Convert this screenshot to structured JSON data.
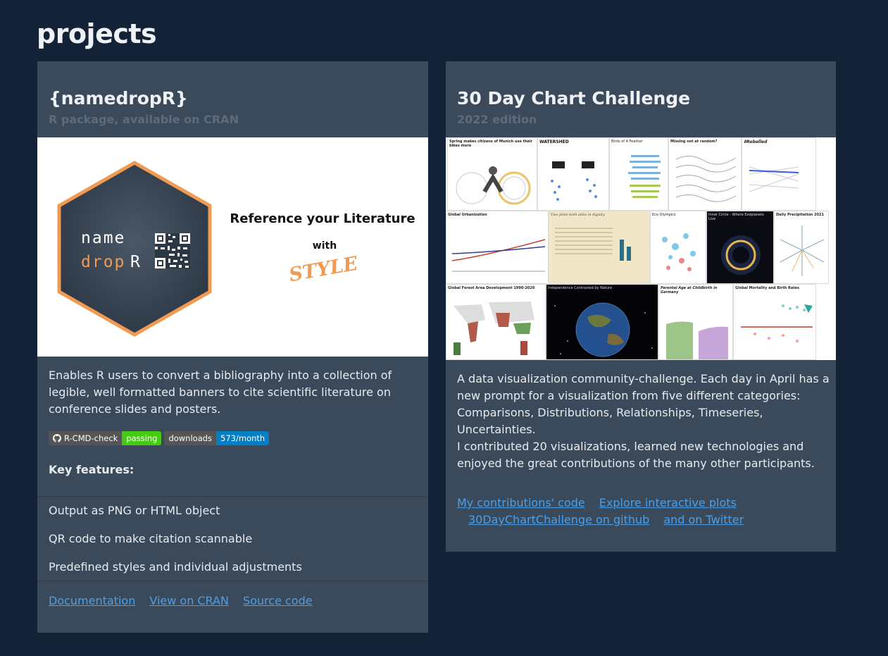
{
  "page": {
    "title": "projects"
  },
  "card1": {
    "title": "{namedropR}",
    "subtitle": "R package, available on CRAN",
    "banner": {
      "hex_name_line1": "name",
      "hex_name_line2a": "drop",
      "hex_name_line2b": "R",
      "headline": "Reference your Literature",
      "with": "with",
      "style": "STYLE"
    },
    "description": "Enables R users to convert a bibliography into a collection of legible, well formatted banners to cite scientific literature on conference slides and posters.",
    "badges": [
      {
        "label": "R-CMD-check",
        "value": "passing"
      },
      {
        "label": "downloads",
        "value": "573/month"
      }
    ],
    "key_features_title": "Key features:",
    "features": [
      "Output as PNG or HTML object",
      "QR code to make citation scannable",
      "Predefined styles and individual adjustments"
    ],
    "links": [
      "Documentation",
      "View on CRAN",
      "Source code"
    ]
  },
  "card2": {
    "title": "30 Day Chart Challenge",
    "subtitle": "2022 edition",
    "description1": "A data visualization community-challenge. Each day in April has a new prompt for a visualization from five different categories: Comparisons, Distributions, Relationships, Timeseries, Uncertainties.",
    "description2": "I contributed 20 visualizations, learned new technologies and enjoyed the great contributions of the many other participants.",
    "links_row1": [
      "My contributions' code",
      "Explore interactive plots"
    ],
    "links_row2": [
      "30DayChartChallenge on github",
      "and on Twitter"
    ],
    "thumbnails": [
      "Spring makes citizens of Munich use their bikes more",
      "WATERSHED",
      "Birds of A Feather",
      "Missing not at random?",
      "#Rebelled",
      "Global Urbanization",
      "Two plots both alike in dignity",
      "Eco Olympics",
      "Inner Circle - Where Exoplanets Live",
      "Daily Precipitation 2021",
      "Global Forest Area Development 1990-2020",
      "Independence Contrasted by Nature",
      "Parental Age at Childbirth in Germany",
      "Global Mortality and Birth Rates"
    ],
    "colors": {
      "accent": "#4a9fe8"
    }
  }
}
